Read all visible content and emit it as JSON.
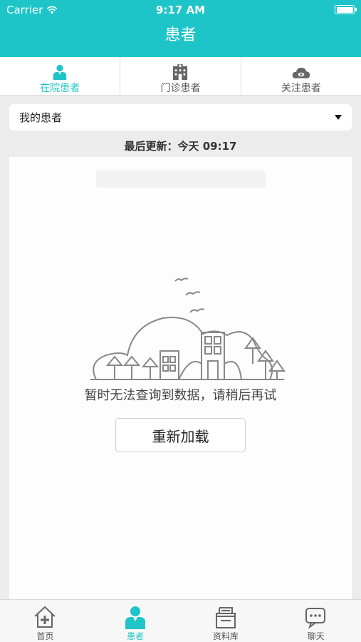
{
  "status_bar": {
    "carrier": "Carrier",
    "time": "9:17 AM"
  },
  "nav": {
    "title": "患者"
  },
  "top_tabs": [
    {
      "label": "在院患者",
      "icon": "doctor-person-icon",
      "active": true
    },
    {
      "label": "门诊患者",
      "icon": "hospital-building-icon",
      "active": false
    },
    {
      "label": "关注患者",
      "icon": "cloud-eye-icon",
      "active": false
    }
  ],
  "dropdown": {
    "selected": "我的患者"
  },
  "update": {
    "text": "最后更新：今天 09:17"
  },
  "empty_state": {
    "message": "暂时无法查询到数据，请稍后再试",
    "reload_label": "重新加载"
  },
  "bottom_tabs": [
    {
      "label": "首页",
      "icon": "home-plus-icon",
      "active": false
    },
    {
      "label": "患者",
      "icon": "doctor-person-icon",
      "active": true
    },
    {
      "label": "资料库",
      "icon": "archive-box-icon",
      "active": false
    },
    {
      "label": "聊天",
      "icon": "chat-bubble-icon",
      "active": false
    }
  ],
  "colors": {
    "accent": "#1ec5c8",
    "background": "#ececec"
  }
}
